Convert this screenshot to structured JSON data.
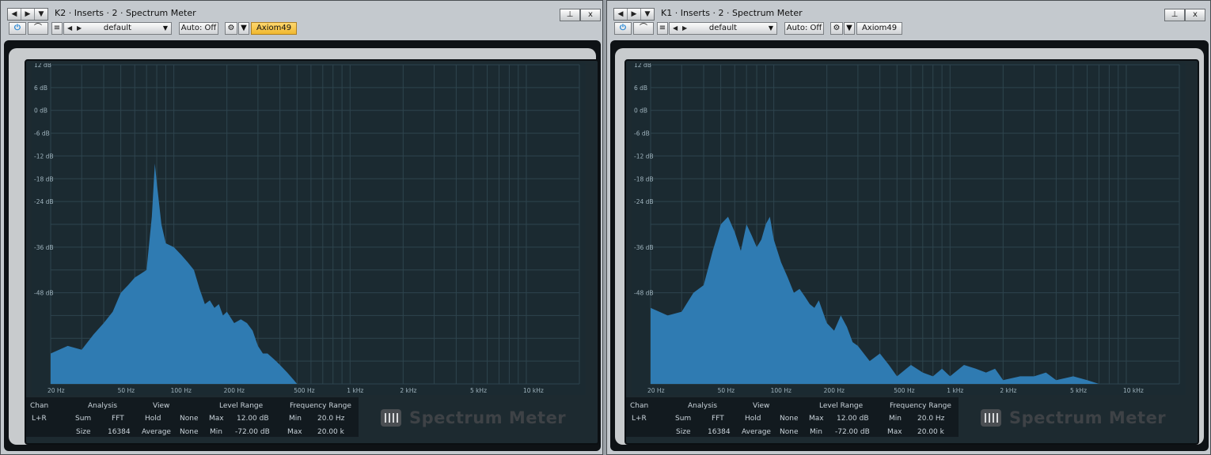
{
  "plugins": [
    {
      "title": "K2 · Inserts · 2 · Spectrum Meter",
      "pin_icon": "pin-icon",
      "close_label": "x",
      "preset": "default",
      "auto": "Auto: Off",
      "device": "Axiom49",
      "device_active": true,
      "info": {
        "chan_header": "Chan",
        "chan": "L+R",
        "analysis_header": "Analysis",
        "sum_label": "Sum",
        "sum_value": "FFT",
        "size_label": "Size",
        "size_value": "16384",
        "view_header": "View",
        "hold_label": "Hold",
        "hold_value": "None",
        "average_label": "Average",
        "average_value": "None",
        "level_header": "Level Range",
        "level_max_label": "Max",
        "level_max": "12.00 dB",
        "level_min_label": "Min",
        "level_min": "-72.00 dB",
        "freq_header": "Frequency Range",
        "freq_min_label": "Min",
        "freq_min": "20.0 Hz",
        "freq_max_label": "Max",
        "freq_max": "20.00 k"
      },
      "brand": "Spectrum Meter",
      "y_ticks": [
        "12 dB",
        "6 dB",
        "0 dB",
        "-6 dB",
        "-12 dB",
        "-18 dB",
        "-24 dB",
        "-36 dB",
        "-48 dB"
      ],
      "x_ticks": [
        "20 Hz",
        "50 Hz",
        "100 Hz",
        "200 Hz",
        "500 Hz",
        "1 kHz",
        "2 kHz",
        "5 kHz",
        "10 kHz"
      ],
      "chart_data": {
        "type": "area",
        "x_unit": "Hz",
        "y_unit": "dB",
        "xlim": [
          20,
          20000
        ],
        "ylim": [
          -72,
          12
        ],
        "x_scale": "log",
        "bar_color": "#2f7bb2",
        "x": [
          20,
          25,
          30,
          35,
          40,
          45,
          50,
          55,
          60,
          65,
          70,
          75,
          78,
          80,
          85,
          90,
          100,
          110,
          120,
          130,
          140,
          150,
          160,
          170,
          180,
          190,
          200,
          220,
          240,
          260,
          280,
          300,
          320,
          340,
          360,
          380,
          400,
          440,
          480,
          500,
          520
        ],
        "y": [
          -64,
          -62,
          -63,
          -59,
          -56,
          -53,
          -48,
          -46,
          -44,
          -43,
          -42,
          -28,
          -14,
          -19,
          -30,
          -35,
          -36,
          -38,
          -40,
          -42,
          -47,
          -51,
          -50,
          -52,
          -51,
          -54,
          -53,
          -56,
          -55,
          -56,
          -58,
          -62,
          -64,
          -64,
          -65,
          -66,
          -67,
          -69,
          -71,
          -72,
          -72
        ]
      }
    },
    {
      "title": "K1 · Inserts · 2 · Spectrum Meter",
      "pin_icon": "pin-icon",
      "close_label": "x",
      "preset": "default",
      "auto": "Auto: Off",
      "device": "Axiom49",
      "device_active": false,
      "info": {
        "chan_header": "Chan",
        "chan": "L+R",
        "analysis_header": "Analysis",
        "sum_label": "Sum",
        "sum_value": "FFT",
        "size_label": "Size",
        "size_value": "16384",
        "view_header": "View",
        "hold_label": "Hold",
        "hold_value": "None",
        "average_label": "Average",
        "average_value": "None",
        "level_header": "Level Range",
        "level_max_label": "Max",
        "level_max": "12.00 dB",
        "level_min_label": "Min",
        "level_min": "-72.00 dB",
        "freq_header": "Frequency Range",
        "freq_min_label": "Min",
        "freq_min": "20.0 Hz",
        "freq_max_label": "Max",
        "freq_max": "20.00 k"
      },
      "brand": "Spectrum Meter",
      "y_ticks": [
        "12 dB",
        "6 dB",
        "0 dB",
        "-6 dB",
        "-12 dB",
        "-18 dB",
        "-24 dB",
        "-36 dB",
        "-48 dB"
      ],
      "x_ticks": [
        "20 Hz",
        "50 Hz",
        "100 Hz",
        "200 Hz",
        "500 Hz",
        "1 kHz",
        "2 kHz",
        "5 kHz",
        "10 kHz"
      ],
      "chart_data": {
        "type": "area",
        "x_unit": "Hz",
        "y_unit": "dB",
        "xlim": [
          20,
          20000
        ],
        "ylim": [
          -72,
          12
        ],
        "x_scale": "log",
        "bar_color": "#2f7bb2",
        "x": [
          20,
          25,
          30,
          35,
          40,
          45,
          50,
          55,
          60,
          65,
          70,
          75,
          80,
          85,
          90,
          95,
          100,
          110,
          120,
          130,
          140,
          150,
          160,
          170,
          180,
          200,
          220,
          240,
          260,
          280,
          300,
          350,
          400,
          450,
          500,
          600,
          700,
          800,
          900,
          1000,
          1200,
          1400,
          1600,
          1800,
          2000,
          2500,
          3000,
          3500,
          4000,
          5000,
          6000,
          7000,
          8000,
          10000,
          12000,
          15000,
          20000
        ],
        "y": [
          -52,
          -54,
          -53,
          -48,
          -46,
          -37,
          -30,
          -28,
          -32,
          -37,
          -30,
          -33,
          -36,
          -34,
          -30,
          -28,
          -34,
          -40,
          -44,
          -48,
          -47,
          -49,
          -51,
          -52,
          -50,
          -56,
          -58,
          -54,
          -57,
          -61,
          -62,
          -66,
          -64,
          -67,
          -70,
          -67,
          -69,
          -70,
          -68,
          -70,
          -67,
          -68,
          -69,
          -68,
          -71,
          -70,
          -70,
          -69,
          -71,
          -70,
          -71,
          -72,
          -72,
          -72,
          -72,
          -72,
          -72
        ]
      }
    }
  ]
}
